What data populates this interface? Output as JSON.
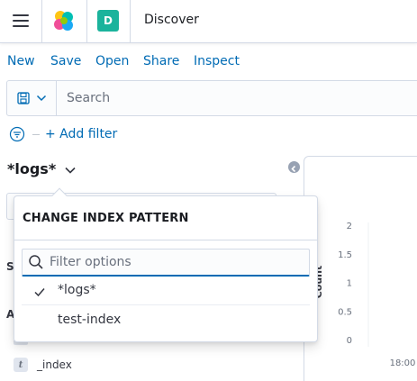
{
  "header": {
    "menu_icon": "hamburger-menu-icon",
    "logo_icon": "elastic-logo-icon",
    "space_initial": "D",
    "space_color": "#1bb39c",
    "app_title": "Discover"
  },
  "topnav": {
    "items": [
      "New",
      "Save",
      "Open",
      "Share",
      "Inspect"
    ],
    "link_color": "#006bb4"
  },
  "search": {
    "saved_query_icon": "save-icon",
    "placeholder": "Search"
  },
  "filters": {
    "filter_icon": "filter-icon",
    "add_filter_label": "+ Add filter"
  },
  "index_pattern": {
    "selected": "*logs*",
    "chevron_icon": "chevron-down-icon"
  },
  "sidebar": {
    "section_s_partial": "S",
    "section_a_partial": "A",
    "fields": [
      {
        "type_glyph": "t",
        "name": "_index"
      }
    ]
  },
  "popover": {
    "title": "CHANGE INDEX PATTERN",
    "filter_placeholder": "Filter options",
    "options": [
      {
        "label": "*logs*",
        "checked": true
      },
      {
        "label": "test-index",
        "checked": false
      }
    ]
  },
  "chart_data": {
    "type": "bar",
    "ylabel": "Count",
    "yticks": [
      "2",
      "1.5",
      "1",
      "0.5",
      "0"
    ],
    "ylim": [
      0,
      2
    ],
    "xticks": [
      "18:00"
    ],
    "series": []
  }
}
